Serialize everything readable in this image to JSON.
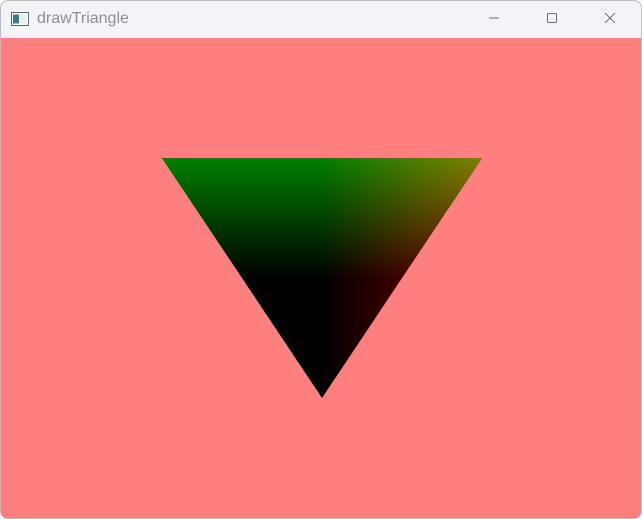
{
  "window": {
    "title": "drawTriangle",
    "client_background": "#ff7f7f",
    "titlebar_background": "#f3f4f8"
  },
  "titlebar": {
    "app_icon": "app-window-icon",
    "controls": {
      "minimize_icon": "minimize-icon",
      "maximize_icon": "maximize-icon",
      "close_icon": "close-icon"
    }
  },
  "canvas": {
    "shape": "triangle",
    "vertex_colors": {
      "top_left": "#008000",
      "top_right": "#808000",
      "bottom": "#000000"
    }
  }
}
